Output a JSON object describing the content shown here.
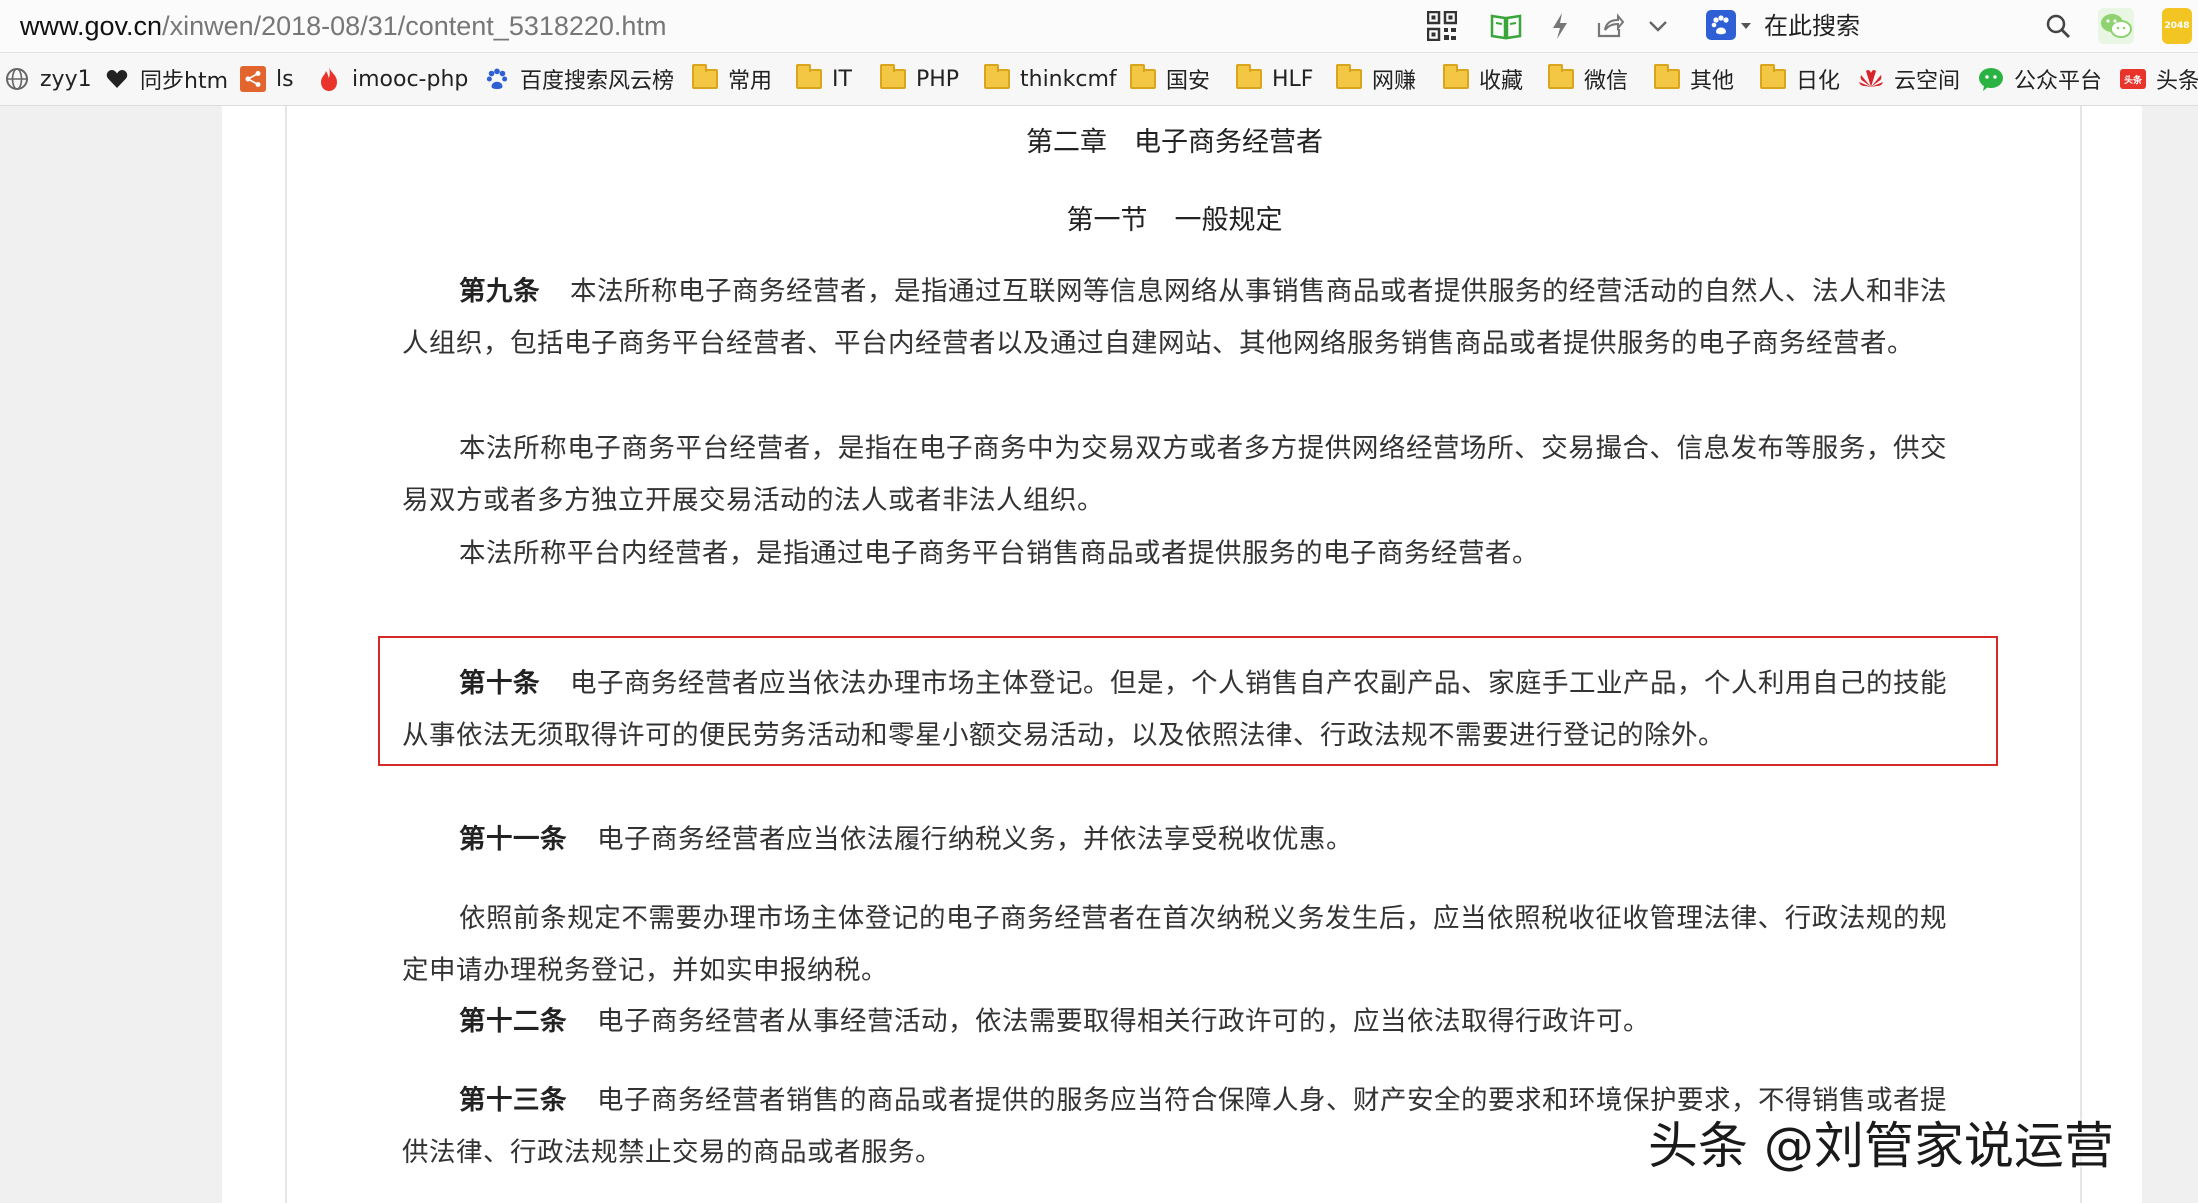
{
  "address_bar": {
    "url_host": "www.gov.cn",
    "url_path": "/xinwen/2018-08/31/content_5318220.htm",
    "icons": [
      "qr-code-icon",
      "reader-mode-icon",
      "lightning-icon",
      "share-icon",
      "chevron-down-icon"
    ],
    "search_engine_icon": "baidu-paw-icon",
    "search_placeholder": "在此搜索",
    "search_icon": "search-icon",
    "extensions": [
      "wechat-extension-icon",
      "2048-extension-icon"
    ],
    "extension_2048_label": "2048"
  },
  "bookmarks": [
    {
      "label": "zyy1",
      "icon": "globe-icon"
    },
    {
      "label": "同步htm",
      "icon": "heart-icon"
    },
    {
      "label": "ls",
      "icon": "share-node-icon"
    },
    {
      "label": "imooc-php",
      "icon": "flame-icon"
    },
    {
      "label": "百度搜索风云榜",
      "icon": "baidu-paw-icon"
    },
    {
      "label": "常用",
      "icon": "folder-icon"
    },
    {
      "label": "IT",
      "icon": "folder-icon"
    },
    {
      "label": "PHP",
      "icon": "folder-icon"
    },
    {
      "label": "thinkcmf",
      "icon": "folder-icon"
    },
    {
      "label": "国安",
      "icon": "folder-icon"
    },
    {
      "label": "HLF",
      "icon": "folder-icon"
    },
    {
      "label": "网赚",
      "icon": "folder-icon"
    },
    {
      "label": "收藏",
      "icon": "folder-icon"
    },
    {
      "label": "微信",
      "icon": "folder-icon"
    },
    {
      "label": "其他",
      "icon": "folder-icon"
    },
    {
      "label": "日化",
      "icon": "folder-icon"
    },
    {
      "label": "云空间",
      "icon": "huawei-icon"
    },
    {
      "label": "公众平台",
      "icon": "wechat-icon"
    },
    {
      "label": "头条",
      "icon": "toutiao-icon",
      "icon_text": "头条"
    }
  ],
  "article": {
    "chapter_title": "第二章　电子商务经营者",
    "section_title": "第一节　一般规定",
    "paragraphs": [
      {
        "article_no": "第九条",
        "text": "本法所称电子商务经营者，是指通过互联网等信息网络从事销售商品或者提供服务的经营活动的自然人、法人和非法人组织，包括电子商务平台经营者、平台内经营者以及通过自建网站、其他网络服务销售商品或者提供服务的电子商务经营者。"
      },
      {
        "article_no": "",
        "text": "本法所称电子商务平台经营者，是指在电子商务中为交易双方或者多方提供网络经营场所、交易撮合、信息发布等服务，供交易双方或者多方独立开展交易活动的法人或者非法人组织。"
      },
      {
        "article_no": "",
        "text": "本法所称平台内经营者，是指通过电子商务平台销售商品或者提供服务的电子商务经营者。"
      },
      {
        "article_no": "第十条",
        "text": "电子商务经营者应当依法办理市场主体登记。但是，个人销售自产农副产品、家庭手工业产品，个人利用自己的技能从事依法无须取得许可的便民劳务活动和零星小额交易活动，以及依照法律、行政法规不需要进行登记的除外。",
        "highlighted": true
      },
      {
        "article_no": "第十一条",
        "text": "电子商务经营者应当依法履行纳税义务，并依法享受税收优惠。"
      },
      {
        "article_no": "",
        "text": "依照前条规定不需要办理市场主体登记的电子商务经营者在首次纳税义务发生后，应当依照税收征收管理法律、行政法规的规定申请办理税务登记，并如实申报纳税。"
      },
      {
        "article_no": "第十二条",
        "text": "电子商务经营者从事经营活动，依法需要取得相关行政许可的，应当依法取得行政许可。"
      },
      {
        "article_no": "第十三条",
        "text": "电子商务经营者销售的商品或者提供的服务应当符合保障人身、财产安全的要求和环境保护要求，不得销售或者提供法律、行政法规禁止交易的商品或者服务。"
      }
    ]
  },
  "watermark": "头条 @刘管家说运营",
  "colors": {
    "highlight_border": "#d42a2a",
    "folder": "#f3c644"
  }
}
